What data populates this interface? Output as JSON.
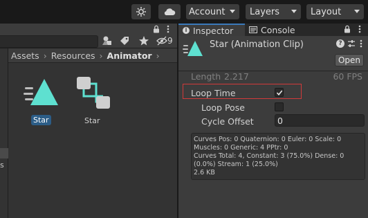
{
  "toolbar": {
    "account_label": "Account",
    "layers_label": "Layers",
    "layout_label": "Layout",
    "icons": [
      "services-icon",
      "cloud-icon"
    ]
  },
  "project": {
    "visible_count": "9",
    "breadcrumb": [
      "Assets",
      "Resources",
      "Animator"
    ],
    "assets": [
      {
        "label": "Star",
        "icon": "animation-clip-icon",
        "selected": true
      },
      {
        "label": "Star",
        "icon": "animator-controller-icon",
        "selected": false
      }
    ],
    "left_edge_text": "s"
  },
  "inspector": {
    "tabs": [
      "Inspector",
      "Console"
    ],
    "title": "Star (Animation Clip)",
    "open_label": "Open",
    "length_label": "Length",
    "length_value": "2.217",
    "fps_value": "60 FPS",
    "loop_time_label": "Loop Time",
    "loop_time_checked": true,
    "loop_pose_label": "Loop Pose",
    "loop_pose_checked": false,
    "cycle_offset_label": "Cycle Offset",
    "cycle_offset_value": "0",
    "info_lines": [
      "Curves Pos: 0 Quaternion: 0 Euler: 0 Scale: 0",
      "Muscles: 0 Generic: 4 PPtr: 0",
      "Curves Total: 4, Constant: 3 (75.0%) Dense: 0",
      "(0.0%) Stream: 1 (25.0%)",
      "2.6 KB"
    ]
  },
  "colors": {
    "accent_teal": "#5ee0d0",
    "selection_blue": "#2c5d87",
    "active_tab_line": "#3a79bb",
    "highlight_red": "#d23a3a"
  }
}
